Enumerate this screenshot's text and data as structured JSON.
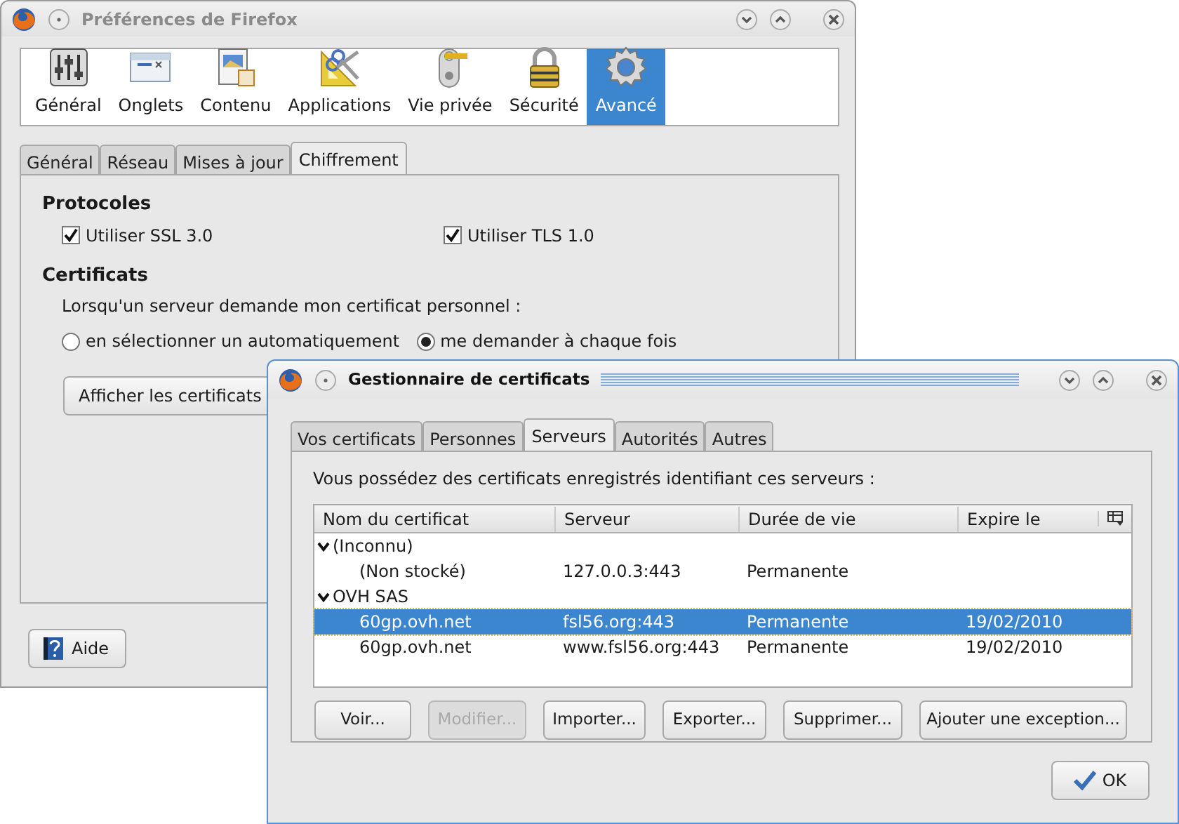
{
  "preferences_window": {
    "title": "Préférences de Firefox",
    "categories": [
      {
        "label": "Général",
        "selected": false
      },
      {
        "label": "Onglets",
        "selected": false
      },
      {
        "label": "Contenu",
        "selected": false
      },
      {
        "label": "Applications",
        "selected": false
      },
      {
        "label": "Vie privée",
        "selected": false
      },
      {
        "label": "Sécurité",
        "selected": false
      },
      {
        "label": "Avancé",
        "selected": true
      }
    ],
    "tabs": [
      {
        "label": "Général",
        "selected": false
      },
      {
        "label": "Réseau",
        "selected": false
      },
      {
        "label": "Mises à jour",
        "selected": false
      },
      {
        "label": "Chiffrement",
        "selected": true
      }
    ],
    "protocols": {
      "heading": "Protocoles",
      "options": [
        {
          "label": "Utiliser SSL 3.0",
          "checked": true
        },
        {
          "label": "Utiliser TLS 1.0",
          "checked": true
        }
      ]
    },
    "certificates": {
      "heading": "Certificats",
      "prompt": "Lorsqu'un serveur demande mon certificat personnel :",
      "choices": [
        {
          "label": "en sélectionner un automatiquement",
          "selected": false
        },
        {
          "label": "me demander à chaque fois",
          "selected": true
        }
      ],
      "button": "Afficher les certificats"
    },
    "help_button": "Aide"
  },
  "certificate_manager": {
    "title": "Gestionnaire de certificats",
    "tabs": [
      {
        "label": "Vos certificats",
        "selected": false
      },
      {
        "label": "Personnes",
        "selected": false
      },
      {
        "label": "Serveurs",
        "selected": true
      },
      {
        "label": "Autorités",
        "selected": false
      },
      {
        "label": "Autres",
        "selected": false
      }
    ],
    "description": "Vous possédez des certificats enregistrés identifiant ces serveurs :",
    "columns": [
      "Nom du certificat",
      "Serveur",
      "Durée de vie",
      "Expire le"
    ],
    "groups": [
      {
        "name": "(Inconnu)",
        "expanded": true,
        "children": [
          {
            "name": "(Non stocké)",
            "server": "127.0.0.3:443",
            "lifetime": "Permanente",
            "selected": false
          }
        ]
      },
      {
        "name": "OVH SAS",
        "expanded": true,
        "children": [
          {
            "name": "60gp.ovh.net",
            "server": "fsl56.org:443",
            "lifetime": "Permanente",
            "expires": "19/02/2010",
            "selected": true
          },
          {
            "name": "60gp.ovh.net",
            "server": "www.fsl56.org:443",
            "lifetime": "Permanente",
            "expires": "19/02/2010",
            "selected": false
          }
        ]
      }
    ],
    "buttons": [
      {
        "label": "Voir...",
        "disabled": false
      },
      {
        "label": "Modifier...",
        "disabled": true
      },
      {
        "label": "Importer...",
        "disabled": false
      },
      {
        "label": "Exporter...",
        "disabled": false
      },
      {
        "label": "Supprimer...",
        "disabled": false
      },
      {
        "label": "Ajouter une exception...",
        "disabled": false
      }
    ],
    "ok_button": "OK"
  }
}
